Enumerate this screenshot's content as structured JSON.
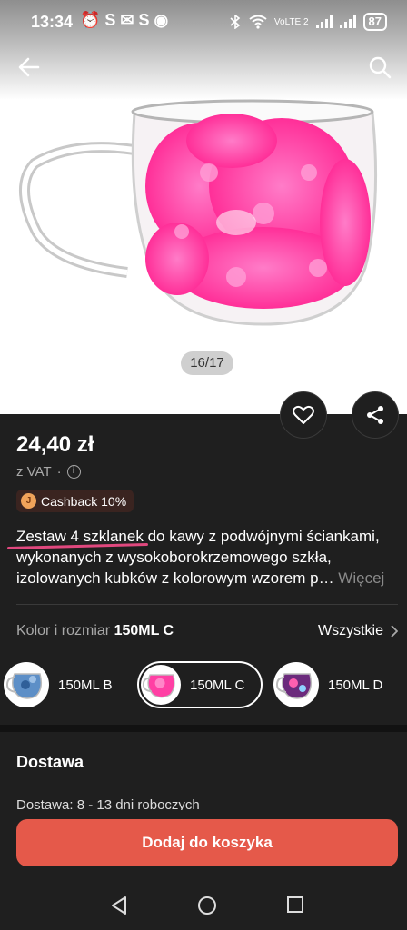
{
  "status_bar": {
    "time": "13:34",
    "left_icons": "⏰ S ✉ S ◉",
    "network": "VoLTE 2",
    "battery": "87"
  },
  "gallery": {
    "page_indicator": "16/17"
  },
  "product": {
    "price": "24,40 zł",
    "vat": "z VAT",
    "cashback": "Cashback 10%",
    "cashback_coin": "J",
    "title_highlight": "Zestaw 4 szklanek",
    "description_rest": " do kawy z podwójnymi ściankami, wykonanych z wysokoborokrzemowego szkła, izolowanych kubków z kolorowym wzorem p…",
    "more_label": "Więcej"
  },
  "variant": {
    "label": "Kolor i rozmiar",
    "selected": "150ML C",
    "see_all": "Wszystkie",
    "options": [
      {
        "label": "150ML B",
        "selected": false
      },
      {
        "label": "150ML C",
        "selected": true
      },
      {
        "label": "150ML D",
        "selected": false
      }
    ]
  },
  "delivery": {
    "title": "Dostawa",
    "hint": "Dostawa: 8 - 13 dni roboczych"
  },
  "cart": {
    "button_label": "Dodaj do koszyka"
  },
  "colors": {
    "accent": "#e5594a",
    "background": "#1f1f1f",
    "highlight": "#e0487e",
    "flower_pink": "#ff3fa4"
  }
}
